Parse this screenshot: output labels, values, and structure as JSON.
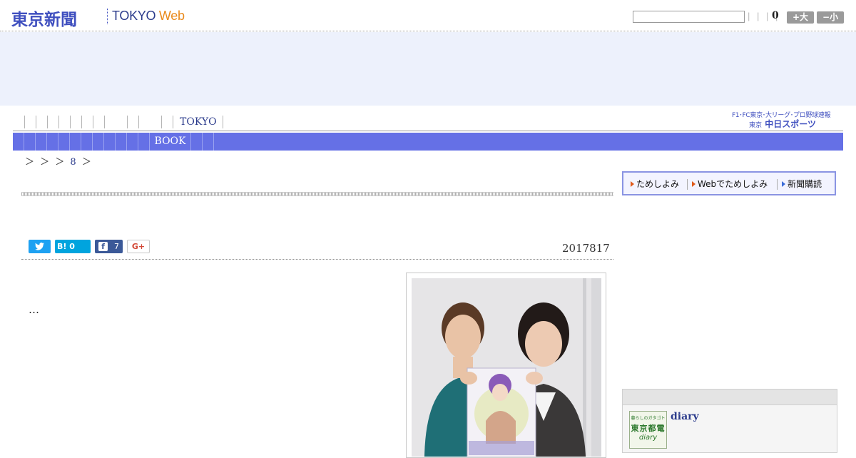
{
  "header": {
    "logo_jp": "東京新聞",
    "logo_en": "TOKYO",
    "logo_en_web": "Web",
    "search_value": "",
    "search_ticks": "| | | |",
    "count": "0",
    "font_large_label": "+大",
    "font_small_label": "−小"
  },
  "nav": {
    "primary_highlight": "TOKYO",
    "secondary_highlight": "BOOK"
  },
  "sports_ad": {
    "top_line": "F1･FC東京･大リーグ･プロ野球速報",
    "prefix": "東京",
    "brand": "中日スポーツ"
  },
  "breadcrumb": {
    "prefix": "＞ ＞ ＞",
    "page": "8",
    "suffix": "＞"
  },
  "article": {
    "date": "2017817",
    "body": "…",
    "share": {
      "twitter_icon": "twitter-bird-icon",
      "hatena_label": "B!",
      "hatena_count": "0",
      "facebook_icon": "facebook-f-icon",
      "facebook_count": "7",
      "google_plus_label": "G+"
    }
  },
  "sidebar": {
    "promo": {
      "item1": "ためしよみ",
      "item2": "Webでためしよみ",
      "item3": "新聞購読"
    },
    "diary": {
      "badge_line1": "暮らしのガタゴト",
      "badge_line2": "東京都電",
      "badge_line3": "diary",
      "title": "diary"
    }
  },
  "colors": {
    "brand_blue": "#3f4fbf",
    "nav_bar": "#6570e6",
    "ad_band": "#edf1fc",
    "web_orange": "#e98a1c"
  }
}
